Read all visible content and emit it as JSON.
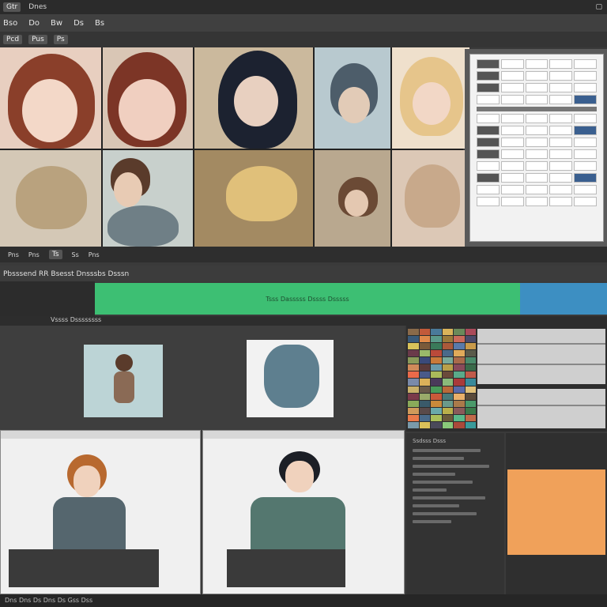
{
  "titlebar": {
    "items": [
      "Gtr",
      "Dnes"
    ]
  },
  "menubar": {
    "items": [
      "Bso",
      "Do",
      "Bw",
      "Ds",
      "Bs"
    ]
  },
  "toolbar": {
    "items": [
      "Pcd",
      "Pus",
      "Ps"
    ]
  },
  "timeline": {
    "items": [
      "Pns",
      "Pns",
      "Ts",
      "Ss",
      "Pns"
    ]
  },
  "section": {
    "label": "Pbsssend RR Bsesst Dnsssbs Dsssn"
  },
  "greenbar": {
    "text": "Tsss Dasssss Dssss Dsssss"
  },
  "subheader": {
    "label": "Vssss Dssssssss"
  },
  "code": {
    "title": "Ssdsss Dsss"
  },
  "status": {
    "text": "Dns Dns Ds Dns Ds Gss Dss"
  },
  "colors": {
    "green": "#3dbf73",
    "blue": "#3d8fc2",
    "orange": "#f0a15a"
  }
}
